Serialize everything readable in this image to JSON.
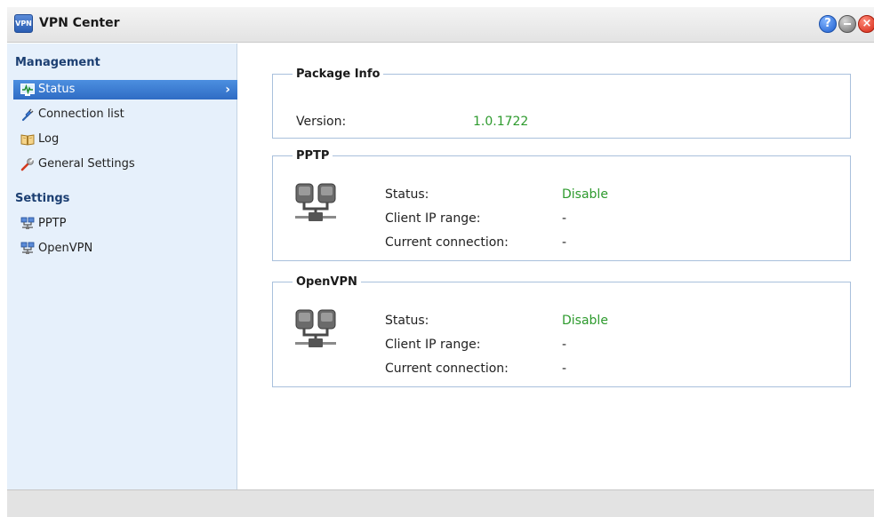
{
  "window": {
    "title": "VPN Center",
    "app_icon_text": "VPN",
    "buttons": {
      "help": "?",
      "close": "×"
    }
  },
  "sidebar": {
    "sections": [
      {
        "title": "Management",
        "items": [
          {
            "label": "Status",
            "icon": "status-monitor-icon",
            "selected": true
          },
          {
            "label": "Connection list",
            "icon": "connection-plug-icon",
            "selected": false
          },
          {
            "label": "Log",
            "icon": "book-icon",
            "selected": false
          },
          {
            "label": "General Settings",
            "icon": "wrench-icon",
            "selected": false
          }
        ]
      },
      {
        "title": "Settings",
        "items": [
          {
            "label": "PPTP",
            "icon": "network-icon",
            "selected": false
          },
          {
            "label": "OpenVPN",
            "icon": "network-icon",
            "selected": false
          }
        ]
      }
    ]
  },
  "main": {
    "package_info": {
      "title": "Package Info",
      "version_label": "Version:",
      "version_value": "1.0.1722"
    },
    "pptp": {
      "title": "PPTP",
      "status_label": "Status:",
      "status_value": "Disable",
      "ip_range_label": "Client IP range:",
      "ip_range_value": "-",
      "current_conn_label": "Current connection:",
      "current_conn_value": "-"
    },
    "openvpn": {
      "title": "OpenVPN",
      "status_label": "Status:",
      "status_value": "Disable",
      "ip_range_label": "Client IP range:",
      "ip_range_value": "-",
      "current_conn_label": "Current connection:",
      "current_conn_value": "-"
    }
  },
  "colors": {
    "selected_bg": "#3a7bd5",
    "status_green": "#2d9a2d",
    "sidebar_bg": "#e6f0fb",
    "section_title": "#1c3f72"
  }
}
